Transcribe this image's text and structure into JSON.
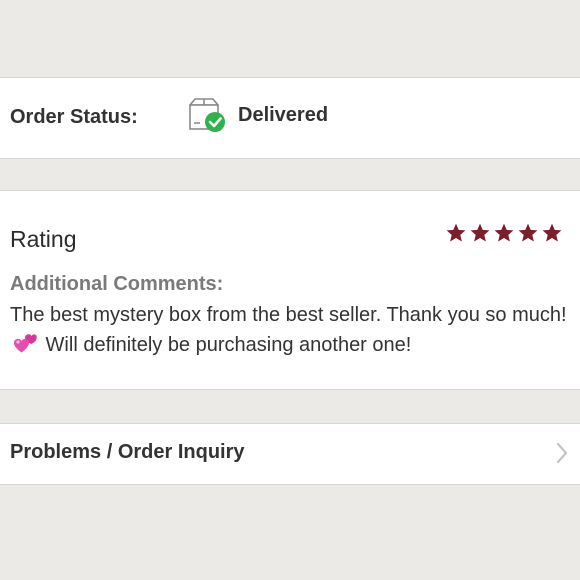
{
  "order_status": {
    "label": "Order Status:",
    "value": "Delivered",
    "icon": "delivered-box-check-icon",
    "check_color": "#2eb34a"
  },
  "rating": {
    "title": "Rating",
    "stars": 5,
    "max_stars": 5,
    "star_color": "#7a1f2b",
    "comments_heading": "Additional Comments:",
    "comments_text_before_emoji": "The best mystery box from the best seller. Thank you so much! ",
    "emoji": "two-hearts-icon",
    "comments_text_after_emoji": " Will definitely be purchasing another one!"
  },
  "inquiry": {
    "label": "Problems / Order Inquiry",
    "icon": "chevron-right-icon"
  }
}
